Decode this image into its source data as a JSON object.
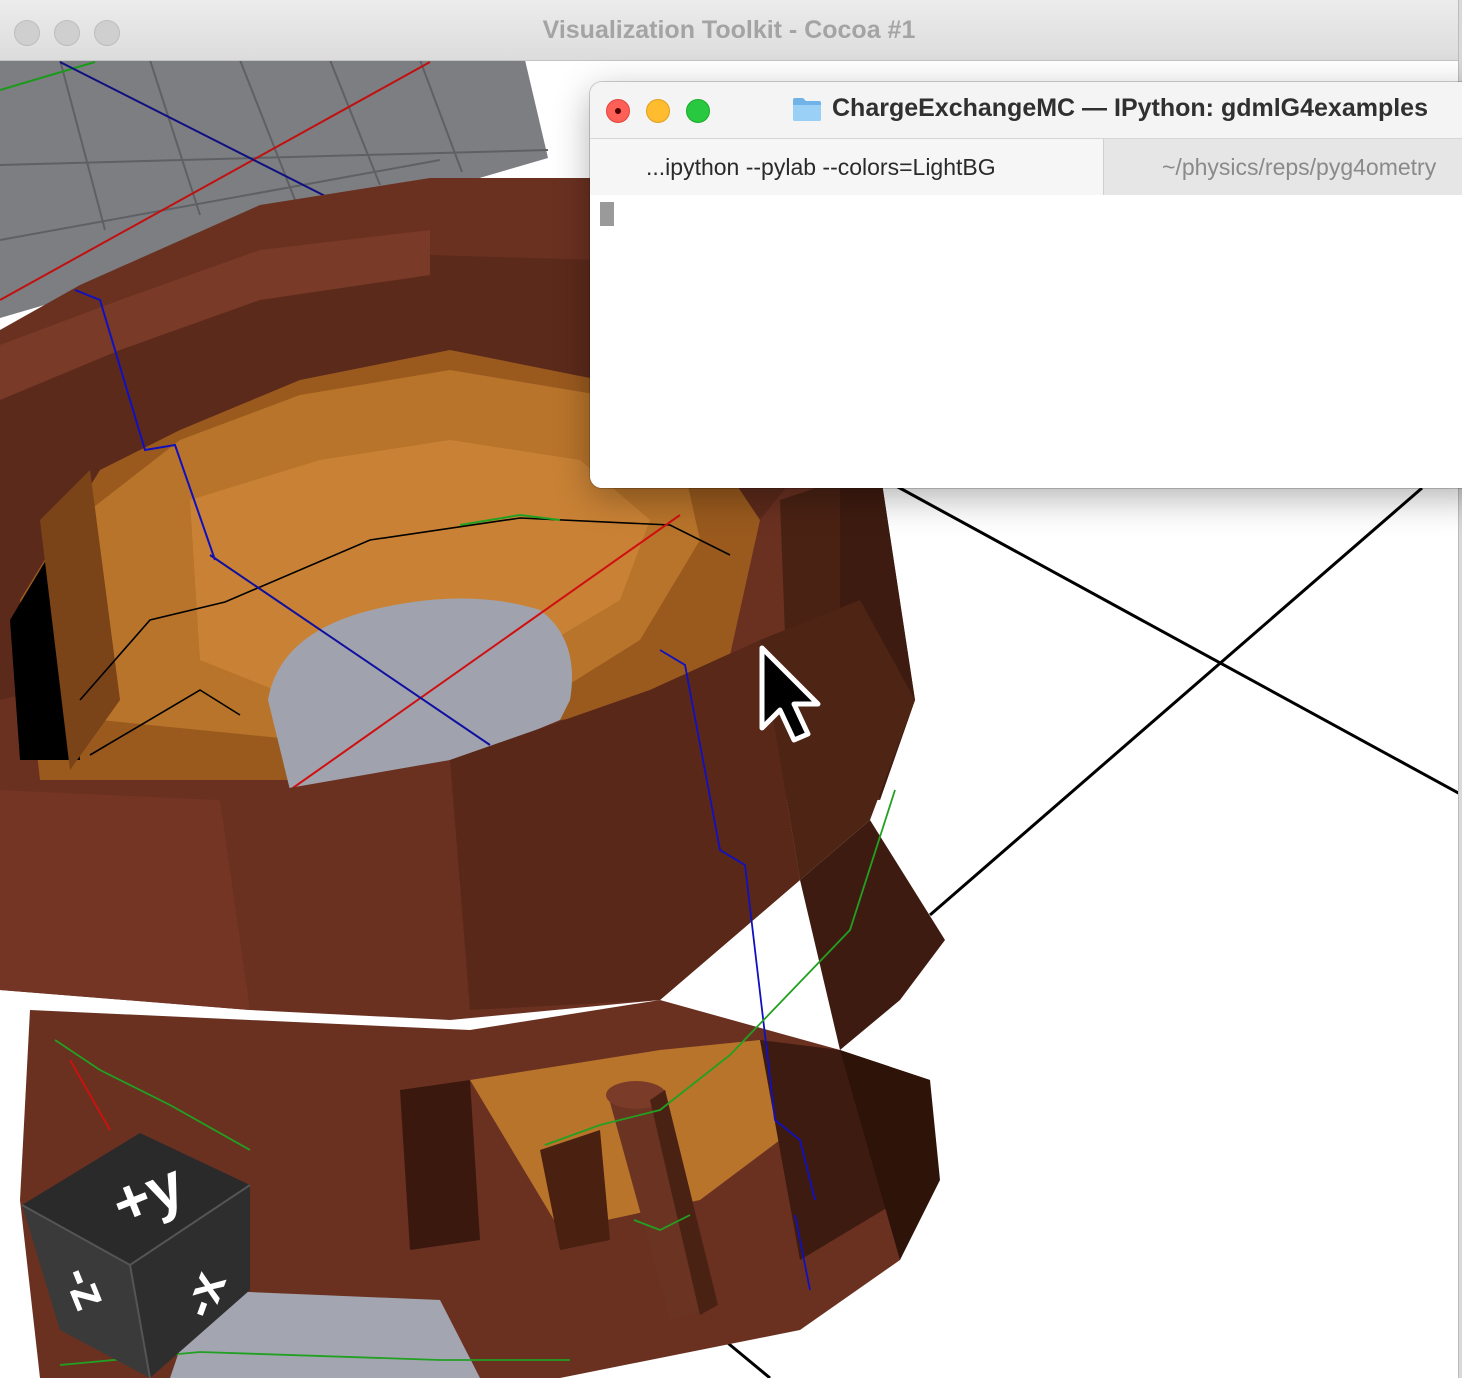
{
  "vtk_window": {
    "title": "Visualization Toolkit - Cocoa #1",
    "colors": {
      "copper": "#6b3322",
      "copper_dark": "#3a1a10",
      "orange_inner": "#b8742a",
      "gray_disk": "#a0a3ae",
      "background": "#ffffff"
    },
    "orientation_cube": {
      "top": "+y",
      "left": "-z",
      "right": "-x"
    }
  },
  "terminal_window": {
    "title": "ChargeExchangeMC — IPython: gdmlG4examples",
    "tabs": [
      {
        "label": "...ipython --pylab --colors=LightBG",
        "active": true
      },
      {
        "label": "~/physics/reps/pyg4ometry",
        "active": false
      }
    ],
    "colors": {
      "close": "#fe5f57",
      "minimize": "#febc2e",
      "maximize": "#28c840"
    }
  }
}
